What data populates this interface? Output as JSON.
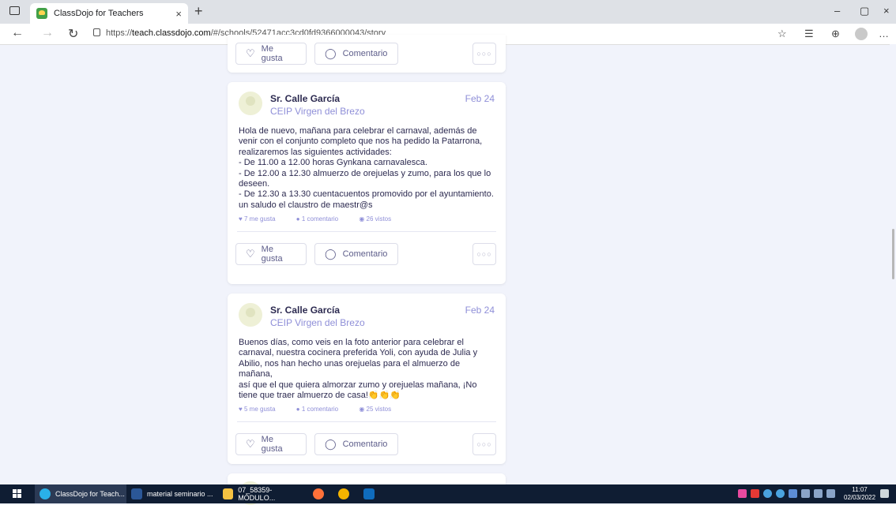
{
  "browser": {
    "tab_title": "ClassDojo for Teachers",
    "tab_close": "×",
    "new_tab": "+",
    "url_prefix": "https://",
    "url_domain": "teach.classdojo.com",
    "url_path": "/#/schools/52471acc3cd0fd9366000043/story",
    "window_controls": [
      "–",
      "▢",
      "×"
    ]
  },
  "feed": {
    "top_actions": {
      "like": "Me gusta",
      "comment": "Comentario",
      "more": "○○○"
    },
    "posts": [
      {
        "author": "Sr. Calle García",
        "school": "CEIP Virgen del Brezo",
        "date": "Feb 24",
        "lines": [
          "Hola de nuevo, mañana para celebrar el carnaval, además de",
          "venir con el conjunto completo que nos ha pedido la Patarrona,",
          "realizaremos las siguientes actividades:",
          "- De 11.00 a 12.00 horas Gynkana carnavalesca.",
          "- De 12.00 a 12.30 almuerzo de orejuelas y zumo, para los que lo",
          "deseen.",
          "- De 12.30 a 13.30 cuentacuentos promovido por el ayuntamiento.",
          "un saludo el claustro de maestr@s"
        ],
        "likes": "7 me gusta",
        "comments": "1 comentario",
        "views": "26 vistos",
        "like_label": "Me gusta",
        "comment_label": "Comentario"
      },
      {
        "author": "Sr. Calle García",
        "school": "CEIP Virgen del Brezo",
        "date": "Feb 24",
        "lines": [
          "Buenos días, como veis en la foto anterior para celebrar el",
          "carnaval, nuestra cocinera preferida Yoli, con ayuda de Julia y",
          "Abilio, nos han hecho unas orejuelas para el almuerzo de mañana,",
          "así que el que quiera almorzar zumo y orejuelas mañana, ¡No",
          "tiene que traer almuerzo de casa!👏👏👏"
        ],
        "likes": "5 me gusta",
        "comments": "1 comentario",
        "views": "25 vistos",
        "like_label": "Me gusta",
        "comment_label": "Comentario"
      }
    ]
  },
  "taskbar": {
    "apps": [
      "ClassDojo for Teach...",
      "material seminario ...",
      "07_58359-MÓDULO..."
    ],
    "time": "11:07",
    "date": "02/03/2022"
  }
}
